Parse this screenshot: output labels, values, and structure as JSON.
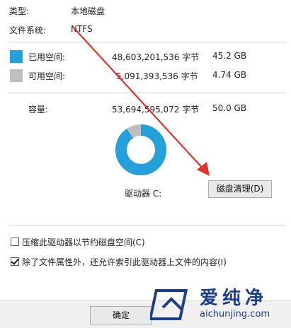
{
  "general": {
    "type_label": "类型:",
    "type_value": "本地磁盘",
    "fs_label": "文件系统:",
    "fs_value": "NTFS"
  },
  "used": {
    "label": "已用空间:",
    "bytes": "48,603,201,536 字节",
    "size": "45.2 GB",
    "color": "#26a0da"
  },
  "free": {
    "label": "可用空间:",
    "bytes": "5,091,393,536 字节",
    "size": "4.74 GB",
    "color": "#bebebe"
  },
  "capacity": {
    "label": "容量:",
    "bytes": "53,694,595,072 字节",
    "size": "50.0 GB"
  },
  "chart": {
    "used_fraction": 0.905
  },
  "drive_label": "驱动器 C:",
  "cleanup_button": "磁盘清理(D)",
  "options": {
    "compress_label": "压缩此驱动器以节约磁盘空间(C)",
    "compress_checked": false,
    "index_label": "除了文件属性外，还允许索引此驱动器上文件的内容(I)",
    "index_checked": true
  },
  "ok_button": "确定",
  "watermark": {
    "brand": "爱纯净",
    "url": "aichunjing.com"
  }
}
